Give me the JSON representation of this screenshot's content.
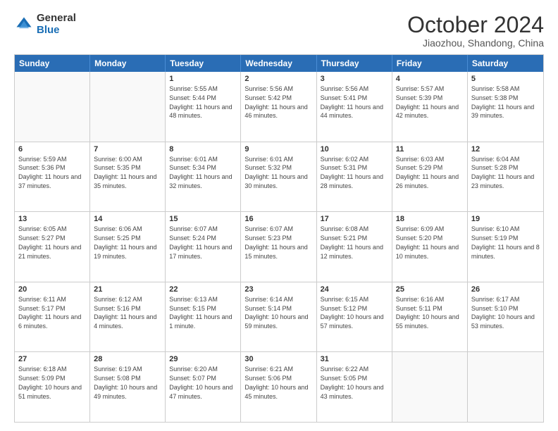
{
  "logo": {
    "general": "General",
    "blue": "Blue"
  },
  "title": "October 2024",
  "subtitle": "Jiaozhou, Shandong, China",
  "header_days": [
    "Sunday",
    "Monday",
    "Tuesday",
    "Wednesday",
    "Thursday",
    "Friday",
    "Saturday"
  ],
  "rows": [
    [
      {
        "day": "",
        "text": "",
        "empty": true
      },
      {
        "day": "",
        "text": "",
        "empty": true
      },
      {
        "day": "1",
        "text": "Sunrise: 5:55 AM\nSunset: 5:44 PM\nDaylight: 11 hours and 48 minutes."
      },
      {
        "day": "2",
        "text": "Sunrise: 5:56 AM\nSunset: 5:42 PM\nDaylight: 11 hours and 46 minutes."
      },
      {
        "day": "3",
        "text": "Sunrise: 5:56 AM\nSunset: 5:41 PM\nDaylight: 11 hours and 44 minutes."
      },
      {
        "day": "4",
        "text": "Sunrise: 5:57 AM\nSunset: 5:39 PM\nDaylight: 11 hours and 42 minutes."
      },
      {
        "day": "5",
        "text": "Sunrise: 5:58 AM\nSunset: 5:38 PM\nDaylight: 11 hours and 39 minutes."
      }
    ],
    [
      {
        "day": "6",
        "text": "Sunrise: 5:59 AM\nSunset: 5:36 PM\nDaylight: 11 hours and 37 minutes."
      },
      {
        "day": "7",
        "text": "Sunrise: 6:00 AM\nSunset: 5:35 PM\nDaylight: 11 hours and 35 minutes."
      },
      {
        "day": "8",
        "text": "Sunrise: 6:01 AM\nSunset: 5:34 PM\nDaylight: 11 hours and 32 minutes."
      },
      {
        "day": "9",
        "text": "Sunrise: 6:01 AM\nSunset: 5:32 PM\nDaylight: 11 hours and 30 minutes."
      },
      {
        "day": "10",
        "text": "Sunrise: 6:02 AM\nSunset: 5:31 PM\nDaylight: 11 hours and 28 minutes."
      },
      {
        "day": "11",
        "text": "Sunrise: 6:03 AM\nSunset: 5:29 PM\nDaylight: 11 hours and 26 minutes."
      },
      {
        "day": "12",
        "text": "Sunrise: 6:04 AM\nSunset: 5:28 PM\nDaylight: 11 hours and 23 minutes."
      }
    ],
    [
      {
        "day": "13",
        "text": "Sunrise: 6:05 AM\nSunset: 5:27 PM\nDaylight: 11 hours and 21 minutes."
      },
      {
        "day": "14",
        "text": "Sunrise: 6:06 AM\nSunset: 5:25 PM\nDaylight: 11 hours and 19 minutes."
      },
      {
        "day": "15",
        "text": "Sunrise: 6:07 AM\nSunset: 5:24 PM\nDaylight: 11 hours and 17 minutes."
      },
      {
        "day": "16",
        "text": "Sunrise: 6:07 AM\nSunset: 5:23 PM\nDaylight: 11 hours and 15 minutes."
      },
      {
        "day": "17",
        "text": "Sunrise: 6:08 AM\nSunset: 5:21 PM\nDaylight: 11 hours and 12 minutes."
      },
      {
        "day": "18",
        "text": "Sunrise: 6:09 AM\nSunset: 5:20 PM\nDaylight: 11 hours and 10 minutes."
      },
      {
        "day": "19",
        "text": "Sunrise: 6:10 AM\nSunset: 5:19 PM\nDaylight: 11 hours and 8 minutes."
      }
    ],
    [
      {
        "day": "20",
        "text": "Sunrise: 6:11 AM\nSunset: 5:17 PM\nDaylight: 11 hours and 6 minutes."
      },
      {
        "day": "21",
        "text": "Sunrise: 6:12 AM\nSunset: 5:16 PM\nDaylight: 11 hours and 4 minutes."
      },
      {
        "day": "22",
        "text": "Sunrise: 6:13 AM\nSunset: 5:15 PM\nDaylight: 11 hours and 1 minute."
      },
      {
        "day": "23",
        "text": "Sunrise: 6:14 AM\nSunset: 5:14 PM\nDaylight: 10 hours and 59 minutes."
      },
      {
        "day": "24",
        "text": "Sunrise: 6:15 AM\nSunset: 5:12 PM\nDaylight: 10 hours and 57 minutes."
      },
      {
        "day": "25",
        "text": "Sunrise: 6:16 AM\nSunset: 5:11 PM\nDaylight: 10 hours and 55 minutes."
      },
      {
        "day": "26",
        "text": "Sunrise: 6:17 AM\nSunset: 5:10 PM\nDaylight: 10 hours and 53 minutes."
      }
    ],
    [
      {
        "day": "27",
        "text": "Sunrise: 6:18 AM\nSunset: 5:09 PM\nDaylight: 10 hours and 51 minutes."
      },
      {
        "day": "28",
        "text": "Sunrise: 6:19 AM\nSunset: 5:08 PM\nDaylight: 10 hours and 49 minutes."
      },
      {
        "day": "29",
        "text": "Sunrise: 6:20 AM\nSunset: 5:07 PM\nDaylight: 10 hours and 47 minutes."
      },
      {
        "day": "30",
        "text": "Sunrise: 6:21 AM\nSunset: 5:06 PM\nDaylight: 10 hours and 45 minutes."
      },
      {
        "day": "31",
        "text": "Sunrise: 6:22 AM\nSunset: 5:05 PM\nDaylight: 10 hours and 43 minutes."
      },
      {
        "day": "",
        "text": "",
        "empty": true
      },
      {
        "day": "",
        "text": "",
        "empty": true
      }
    ]
  ]
}
